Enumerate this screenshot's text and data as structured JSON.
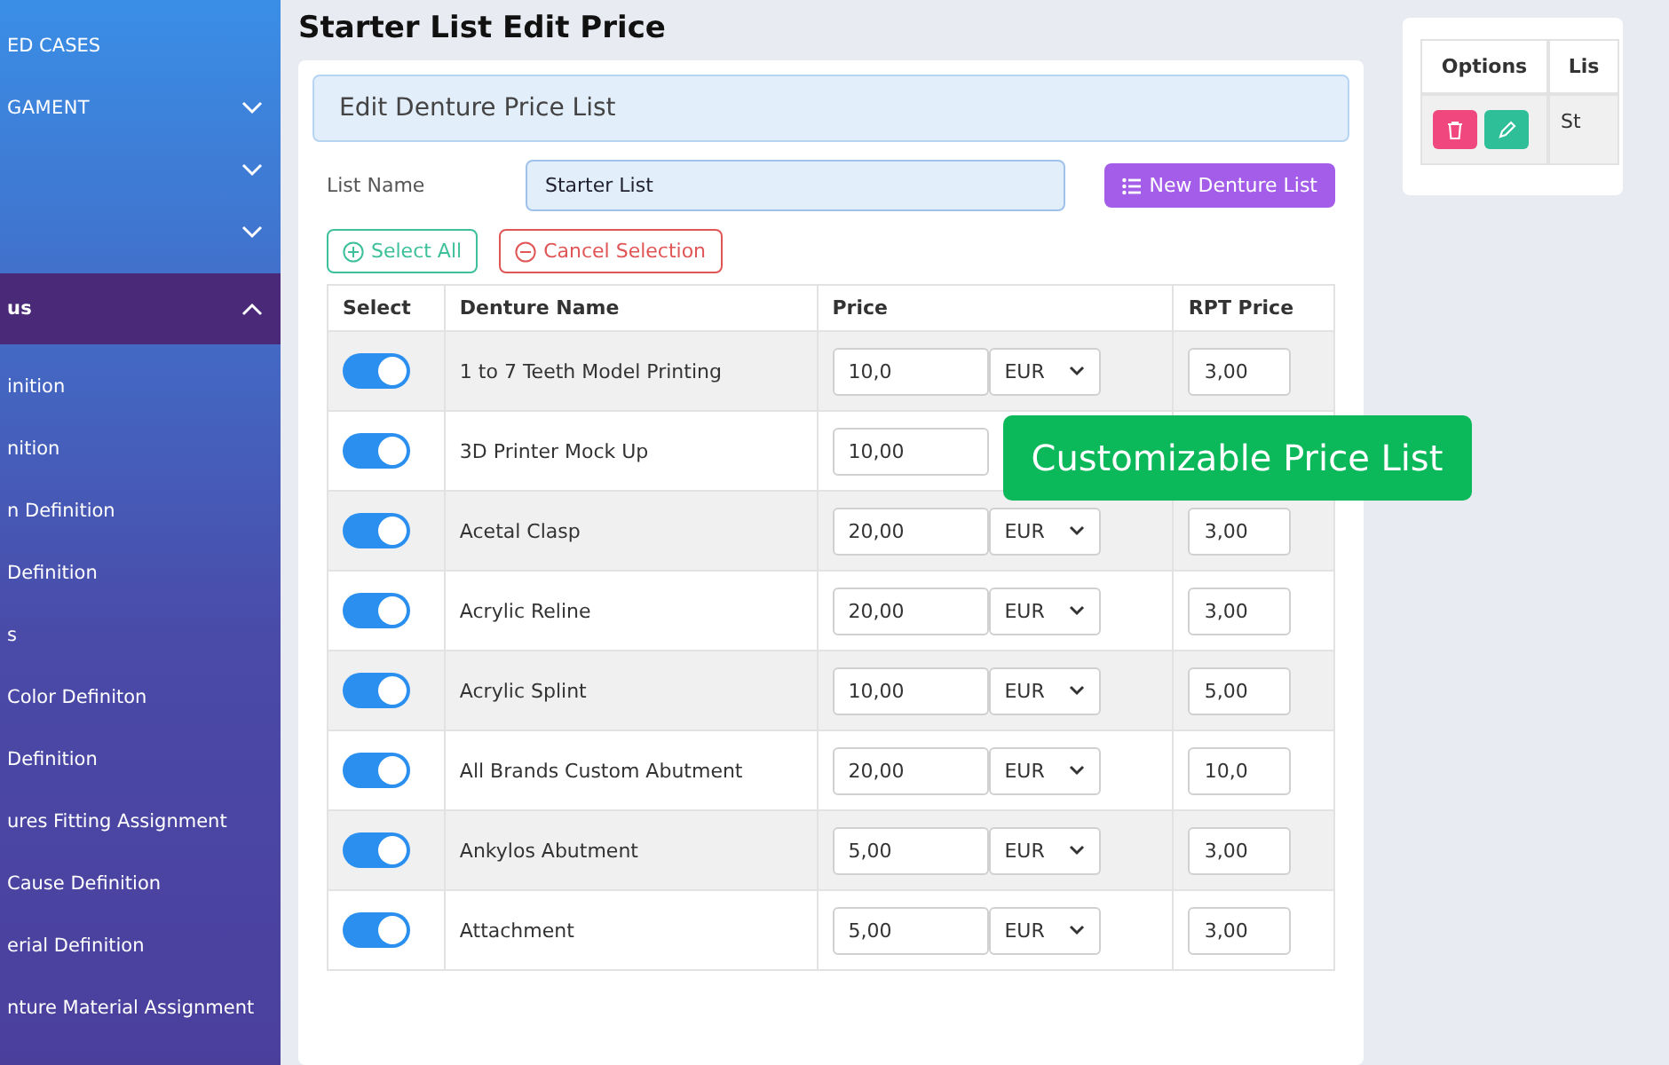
{
  "sidebar": {
    "items": [
      {
        "label": "ED CASES",
        "kind": "link",
        "selected": false
      },
      {
        "label": "GAMENT",
        "kind": "group",
        "expanded": false,
        "selected": false
      },
      {
        "kind": "group",
        "expanded": false,
        "selected": false
      },
      {
        "kind": "group",
        "expanded": false,
        "selected": false
      },
      {
        "label": "us",
        "kind": "group",
        "expanded": true,
        "selected": true
      },
      {
        "label": "inition",
        "kind": "link",
        "selected": false
      },
      {
        "label": "nition",
        "kind": "link",
        "selected": false
      },
      {
        "label": "n Definition",
        "kind": "link",
        "selected": false
      },
      {
        "label": "Definition",
        "kind": "link",
        "selected": false
      },
      {
        "label": "s",
        "kind": "link",
        "selected": false
      },
      {
        "label": "Color Definiton",
        "kind": "link",
        "selected": false
      },
      {
        "label": "Definition",
        "kind": "link",
        "selected": false
      },
      {
        "label": "ures Fitting Assignment",
        "kind": "link",
        "selected": false
      },
      {
        "label": "Cause Definition",
        "kind": "link",
        "selected": false
      },
      {
        "label": "erial Definition",
        "kind": "link",
        "selected": false
      },
      {
        "label": "nture Material Assignment",
        "kind": "link",
        "selected": false
      }
    ]
  },
  "page": {
    "title": "Starter List Edit Price"
  },
  "editor": {
    "title": "Edit Denture Price List",
    "list_name_label": "List Name",
    "list_name_value": "Starter List",
    "new_button": "New Denture List",
    "select_all": "Select All",
    "cancel_selection": "Cancel Selection",
    "columns": {
      "select": "Select",
      "name": "Denture Name",
      "price": "Price",
      "rpt": "RPT Price"
    },
    "rows": [
      {
        "on": true,
        "name": "1 to 7 Teeth Model Printing",
        "price": "10,0",
        "currency": "EUR",
        "rpt": "3,00"
      },
      {
        "on": true,
        "name": "3D Printer Mock Up",
        "price": "10,00"
      },
      {
        "on": true,
        "name": "Acetal Clasp",
        "price": "20,00",
        "currency": "EUR",
        "rpt": "3,00"
      },
      {
        "on": true,
        "name": "Acrylic Reline",
        "price": "20,00",
        "currency": "EUR",
        "rpt": "3,00"
      },
      {
        "on": true,
        "name": "Acrylic Splint",
        "price": "10,00",
        "currency": "EUR",
        "rpt": "5,00"
      },
      {
        "on": true,
        "name": "All Brands Custom Abutment",
        "price": "20,00",
        "currency": "EUR",
        "rpt": "10,0"
      },
      {
        "on": true,
        "name": "Ankylos Abutment",
        "price": "5,00",
        "currency": "EUR",
        "rpt": "3,00"
      },
      {
        "on": true,
        "name": "Attachment",
        "price": "5,00",
        "currency": "EUR",
        "rpt": "3,00"
      }
    ]
  },
  "lists_card": {
    "columns": [
      "Options",
      "Lis"
    ],
    "rows": [
      {
        "cell": "St"
      }
    ]
  },
  "callout": {
    "text": "Customizable Price List"
  }
}
